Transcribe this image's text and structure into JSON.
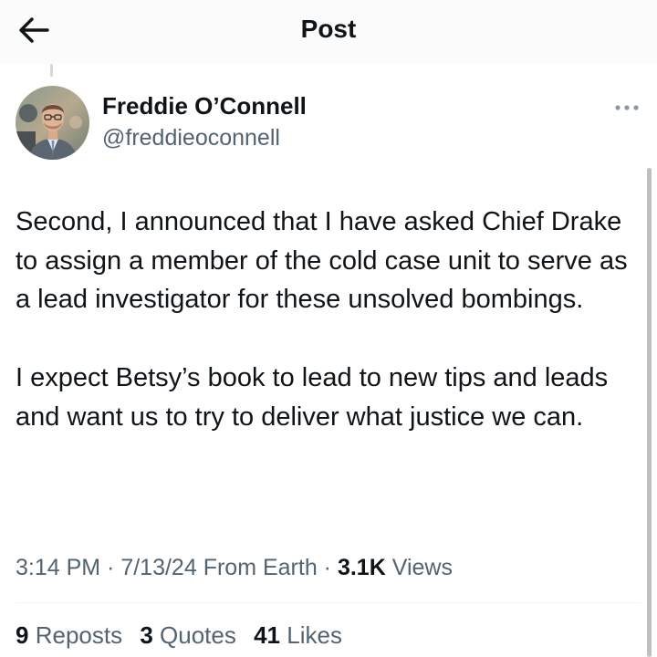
{
  "header": {
    "title": "Post",
    "back_icon": "arrow-left-icon"
  },
  "author": {
    "name": "Freddie O’Connell",
    "handle": "@freddieoconnell",
    "more_icon": "more-horizontal-icon"
  },
  "post": {
    "paragraphs": [
      "Second, I announced that I have asked Chief Drake to assign a member of the cold case unit to serve as a lead investigator for these unsolved bombings.",
      "I expect Betsy’s book to lead to new tips and leads and want us to try to deliver what justice we can."
    ]
  },
  "meta": {
    "time": "3:14 PM",
    "separator": " · ",
    "date": "7/13/24",
    "source": "From Earth",
    "views_count": "3.1K",
    "views_label": "Views"
  },
  "stats": {
    "reposts_count": "9",
    "reposts_label": "Reposts",
    "quotes_count": "3",
    "quotes_label": "Quotes",
    "likes_count": "41",
    "likes_label": "Likes"
  },
  "colors": {
    "text_primary": "#0f1419",
    "text_secondary": "#536471",
    "divider": "#eff3f4"
  }
}
